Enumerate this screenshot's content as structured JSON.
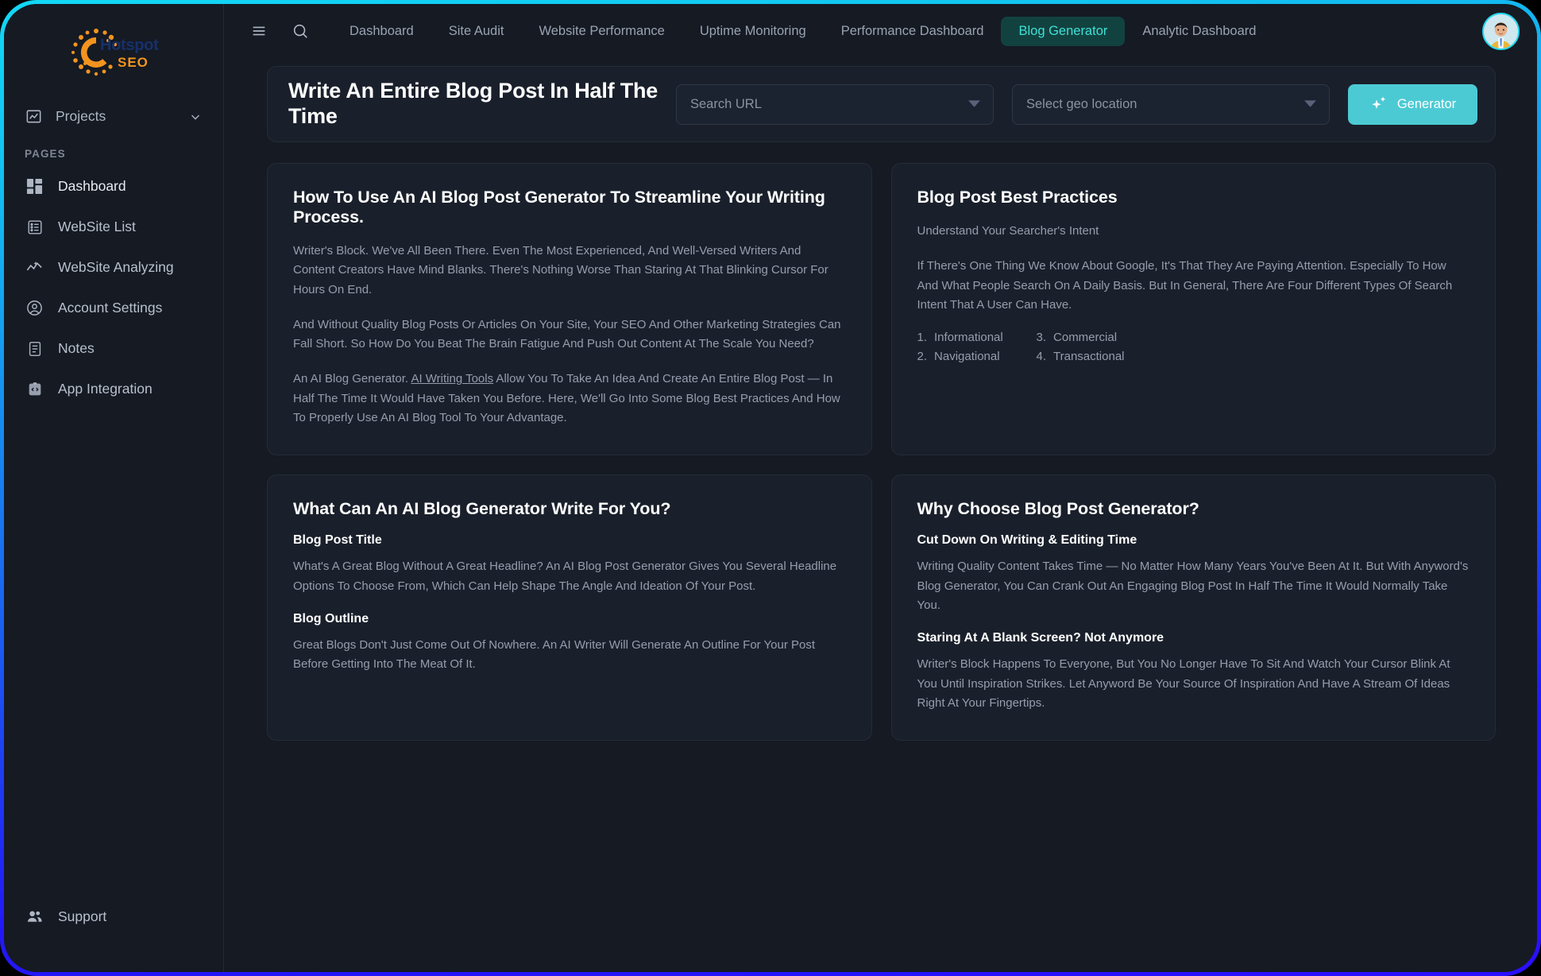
{
  "brand": {
    "name_primary": "Hotspot",
    "name_secondary": "SEO",
    "logo_icon": "sun-dots-logo",
    "accent_orange": "#f2941f",
    "accent_navy": "#17306b"
  },
  "theme": {
    "frame_gradient_start": "#12d8f5",
    "frame_gradient_end": "#2a10ff",
    "page_bg": "#151a23",
    "card_bg": "#1a202b",
    "card_border": "#242b37",
    "accent_teal": "#4ccad4",
    "active_tab_bg": "#12423f",
    "active_tab_text": "#3fe0d8",
    "body_text": "#959dad",
    "heading_text": "#ffffff"
  },
  "sidebar": {
    "projects": {
      "label": "Projects",
      "icon": "chart-document-icon",
      "chevron": "chevron-down-icon"
    },
    "section_label": "PAGES",
    "items": [
      {
        "label": "Dashboard",
        "icon": "dashboard-grid-icon",
        "active": true
      },
      {
        "label": "WebSite List",
        "icon": "list-icon",
        "active": false
      },
      {
        "label": "WebSite Analyzing",
        "icon": "analytics-line-icon",
        "active": false
      },
      {
        "label": "Account Settings",
        "icon": "user-circle-icon",
        "active": false
      },
      {
        "label": "Notes",
        "icon": "note-icon",
        "active": false
      },
      {
        "label": "App Integration",
        "icon": "code-app-icon",
        "active": false
      }
    ],
    "support": {
      "label": "Support",
      "icon": "people-icon"
    }
  },
  "topbar": {
    "menu_icon": "hamburger-menu-icon",
    "search_icon": "search-icon",
    "tabs": [
      {
        "label": "Dashboard",
        "active": false
      },
      {
        "label": "Site Audit",
        "active": false
      },
      {
        "label": "Website Performance",
        "active": false
      },
      {
        "label": "Uptime Monitoring",
        "active": false
      },
      {
        "label": "Performance Dashboard",
        "active": false
      },
      {
        "label": "Blog Generator",
        "active": true
      },
      {
        "label": "Analytic Dashboard",
        "active": false
      }
    ],
    "avatar": {
      "icon": "user-avatar",
      "alt": "User profile avatar"
    }
  },
  "hero": {
    "title": "Write An Entire Blog Post In Half The Time",
    "search_url_select": {
      "value": "Search URL",
      "placeholder": "Search URL",
      "caret": "caret-down-icon"
    },
    "geo_select": {
      "value": "Select geo location",
      "placeholder": "Select geo location",
      "caret": "caret-down-icon"
    },
    "generator_button": {
      "label": "Generator",
      "icon": "sparkle-icon"
    }
  },
  "cards": {
    "how_to_use": {
      "title": "How To Use An AI Blog Post Generator To Streamline Your Writing Process.",
      "p1": "Writer's Block. We've All Been There. Even The Most Experienced, And Well-Versed Writers And Content Creators Have Mind Blanks. There's Nothing Worse Than Staring At That Blinking Cursor For Hours On End.",
      "p2": "And Without Quality Blog Posts Or Articles On Your Site, Your SEO And Other Marketing Strategies Can Fall Short. So How Do You Beat The Brain Fatigue And Push Out Content At The Scale You Need?",
      "p3_before": "An AI Blog Generator. ",
      "p3_link": "AI Writing Tools",
      "p3_after": " Allow You To Take An Idea And Create An Entire Blog Post — In Half The Time It Would Have Taken You Before. Here, We'll Go Into Some Blog Best Practices And How To Properly Use An AI Blog Tool To Your Advantage."
    },
    "best_practices": {
      "title": "Blog Post Best Practices",
      "lead": "Understand Your Searcher's Intent",
      "body": "If There's One Thing We Know About Google, It's That They Are Paying Attention. Especially To How And What People Search On A Daily Basis. But In General, There Are Four Different Types Of Search Intent That A User Can Have.",
      "intent_list": [
        {
          "num": "1.",
          "label": "Informational"
        },
        {
          "num": "2.",
          "label": "Navigational"
        },
        {
          "num": "3.",
          "label": "Commercial"
        },
        {
          "num": "4.",
          "label": "Transactional"
        }
      ]
    },
    "what_can_write": {
      "title": "What Can An AI Blog Generator Write For You?",
      "sub1": "Blog Post Title",
      "body1": "What's A Great Blog Without A Great Headline? An AI Blog Post Generator Gives You Several Headline Options To Choose From, Which Can Help Shape The Angle And Ideation Of Your Post.",
      "sub2": "Blog Outline",
      "body2": "Great Blogs Don't Just Come Out Of Nowhere. An AI Writer Will Generate An Outline For Your Post Before Getting Into The Meat Of It."
    },
    "why_choose": {
      "title": "Why Choose Blog Post Generator?",
      "sub1": "Cut Down On Writing & Editing Time",
      "body1": "Writing Quality Content Takes Time — No Matter How Many Years You've Been At It. But With Anyword's Blog Generator, You Can Crank Out An Engaging Blog Post In Half The Time It Would Normally Take You.",
      "sub2": "Staring At A Blank Screen? Not Anymore",
      "body2": "Writer's Block Happens To Everyone, But You No Longer Have To Sit And Watch Your Cursor Blink At You Until Inspiration Strikes. Let Anyword Be Your Source Of Inspiration And Have A Stream Of Ideas Right At Your Fingertips."
    }
  }
}
